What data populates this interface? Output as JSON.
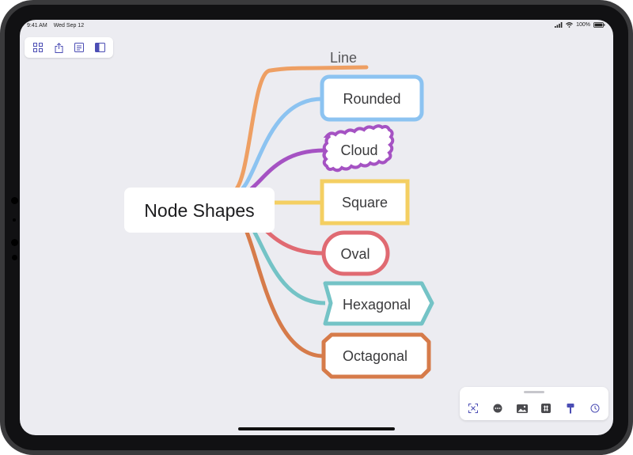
{
  "status_bar": {
    "time": "9:41 AM",
    "date": "Wed Sep 12",
    "battery": "100%"
  },
  "toolbar": {
    "items": [
      {
        "icon": "outline-icon"
      },
      {
        "icon": "share-icon"
      },
      {
        "icon": "notes-icon"
      },
      {
        "icon": "sidebar-icon",
        "active": true
      }
    ]
  },
  "mindmap": {
    "central_topic": "Node Shapes",
    "nodes": [
      {
        "label": "Line",
        "shape": "line",
        "color": "#EE9F63"
      },
      {
        "label": "Rounded",
        "shape": "rounded",
        "color": "#8CC3F1"
      },
      {
        "label": "Cloud",
        "shape": "cloud",
        "color": "#A552C3"
      },
      {
        "label": "Square",
        "shape": "square",
        "color": "#F4CF62"
      },
      {
        "label": "Oval",
        "shape": "oval",
        "color": "#E06A72"
      },
      {
        "label": "Hexagonal",
        "shape": "hexagon",
        "color": "#74C3C6"
      },
      {
        "label": "Octagonal",
        "shape": "octagon",
        "color": "#D67B4A"
      }
    ]
  },
  "bottom_toolbar": {
    "tools": [
      {
        "icon": "focus-icon"
      },
      {
        "icon": "more-icon"
      },
      {
        "icon": "image-icon"
      },
      {
        "icon": "sticker-icon"
      },
      {
        "icon": "format-icon"
      },
      {
        "icon": "timer-icon"
      }
    ]
  },
  "colors": {
    "canvas": "#ECECF1",
    "accent": "#4B4DB4",
    "bezel": "#111113"
  }
}
